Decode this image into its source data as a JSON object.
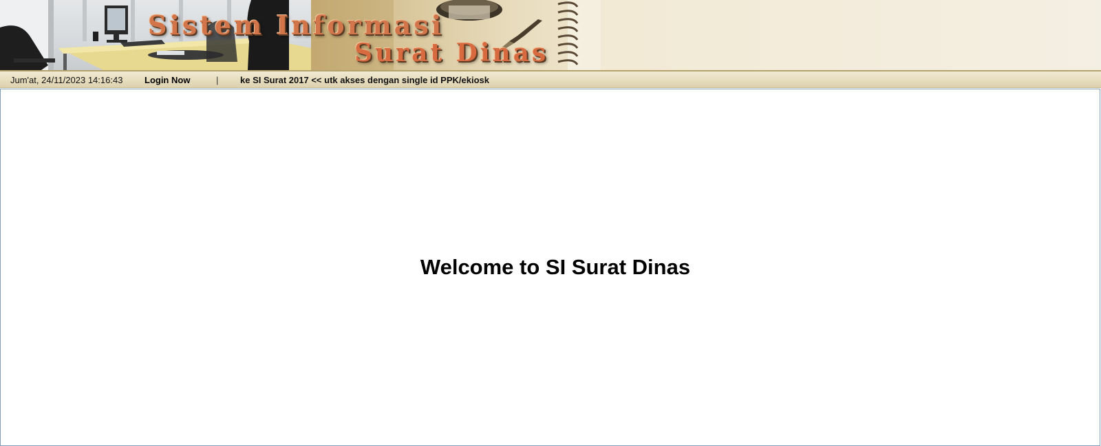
{
  "header": {
    "title": "Sistem Informasi",
    "subtitle": "Surat Dinas"
  },
  "statusbar": {
    "datetime": "Jum'at, 24/11/2023 14:16:43",
    "login_label": "Login Now",
    "separator": "|",
    "ticker_text": "ke SI Surat 2017 << utk akses dengan single id PPK/ekiosk"
  },
  "main": {
    "welcome": "Welcome to SI Surat Dinas"
  },
  "colors": {
    "banner_bg": "#f2ead4",
    "statusbar_bg": "#e6dcbd",
    "title_color": "#d2754a",
    "frame_border": "#7f9db9"
  },
  "icons": [
    "office-photo",
    "desk-photo",
    "spiral-binding-icon"
  ]
}
